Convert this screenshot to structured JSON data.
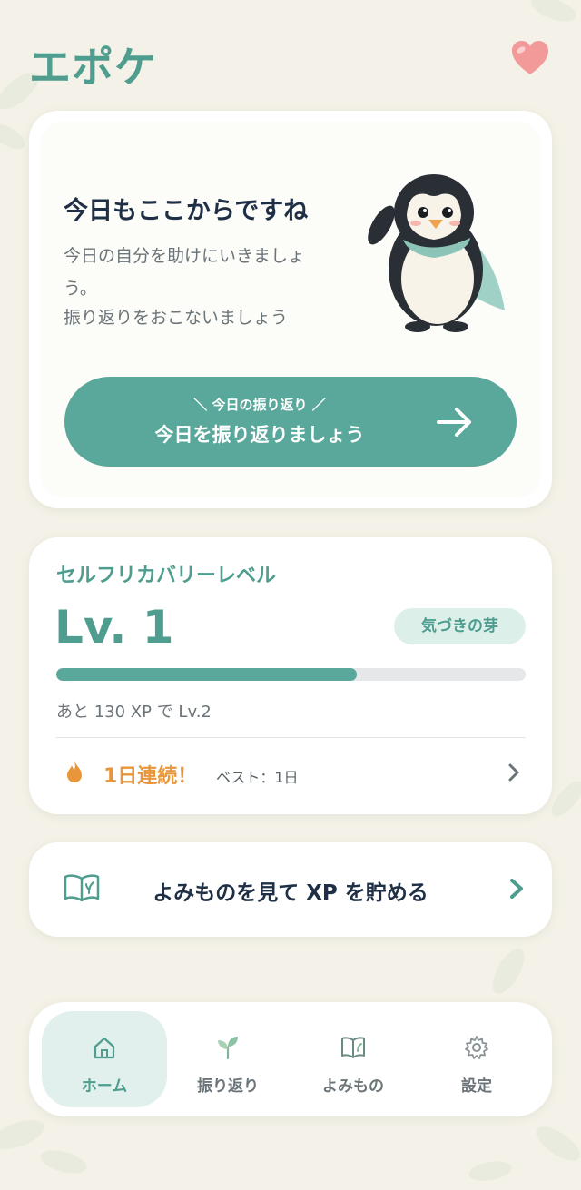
{
  "app": {
    "title": "エポケ"
  },
  "header": {
    "favorite_icon": "heart-icon"
  },
  "hero": {
    "title": "今日もここからですね",
    "text_line1": "今日の自分を助けにいきましょ",
    "text_line2": "う。",
    "text_line3": "振り返りをおこないましょう",
    "cta_sub": "＼ 今日の振り返り ／",
    "cta_main": "今日を振り返りましょう",
    "cta_icon": "arrow-right-icon",
    "mascot": "penguin-mascot"
  },
  "level": {
    "label": "セルフリカバリーレベル",
    "value": "Lv. 1",
    "badge": "気づきの芽",
    "progress": 0.64,
    "remaining": "あと 130 XP で Lv.2",
    "streak": "1日連続！",
    "best": "ベスト：1日"
  },
  "reading": {
    "label": "よみものを見て XP を貯める",
    "icon": "book-icon"
  },
  "nav": {
    "items": [
      {
        "label": "ホーム",
        "icon": "home-icon",
        "active": true
      },
      {
        "label": "振り返り",
        "icon": "sprout-icon",
        "active": false
      },
      {
        "label": "よみもの",
        "icon": "book-icon",
        "active": false
      },
      {
        "label": "設定",
        "icon": "gear-icon",
        "active": false
      }
    ]
  },
  "colors": {
    "accent": "#5aa89b",
    "accent_text": "#4e9d8f",
    "streak": "#e9953a",
    "background": "#f4f2e8",
    "heart": "#f29a9a"
  }
}
